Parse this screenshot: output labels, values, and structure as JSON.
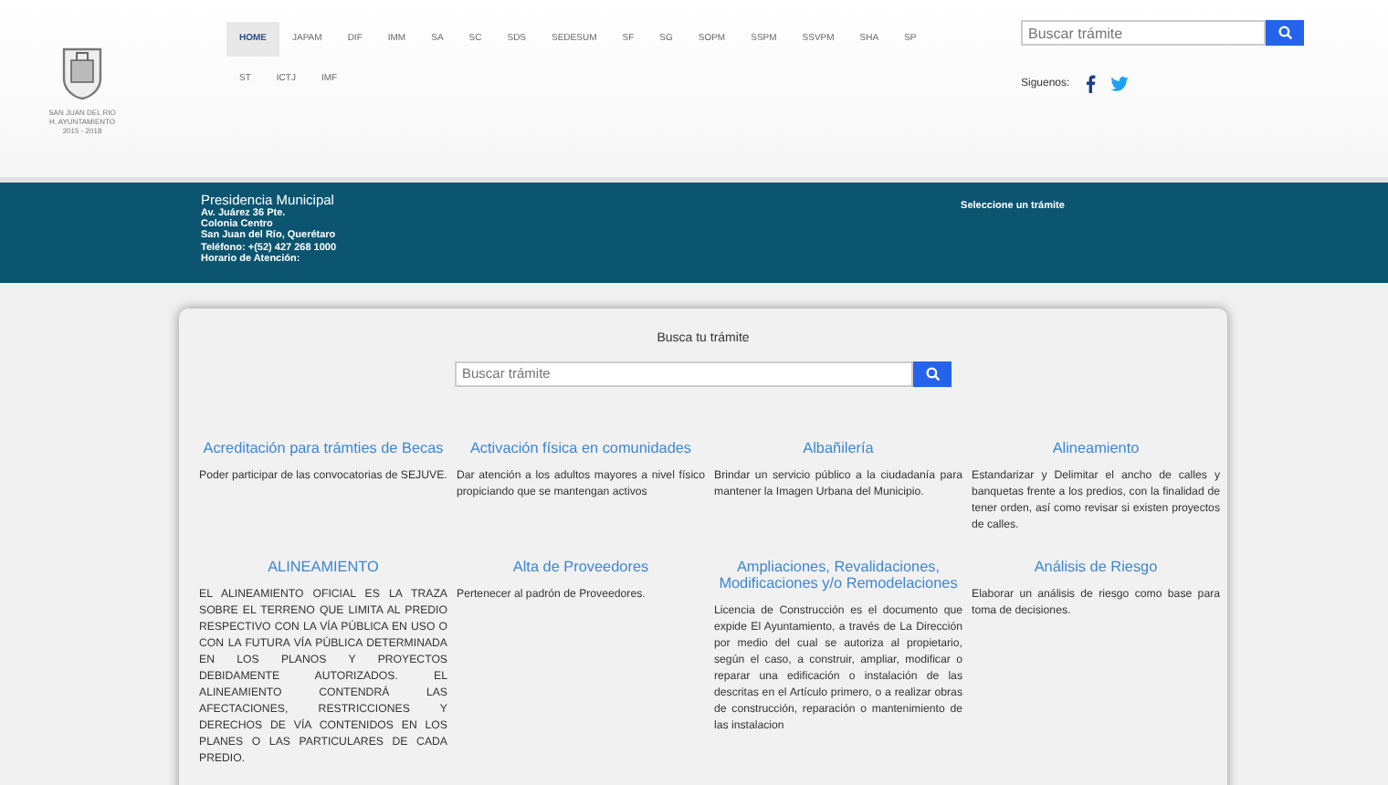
{
  "logo": {
    "caption": [
      "SAN JUAN DEL RIO",
      "H. AYUNTAMIENTO",
      "2015 - 2018"
    ]
  },
  "nav": [
    {
      "label": "HOME",
      "selected": true
    },
    {
      "label": "JAPAM",
      "selected": false
    },
    {
      "label": "DIF",
      "selected": false
    },
    {
      "label": "IMM",
      "selected": false
    },
    {
      "label": "SA",
      "selected": false
    },
    {
      "label": "SC",
      "selected": false
    },
    {
      "label": "SDS",
      "selected": false
    },
    {
      "label": "SEDESUM",
      "selected": false
    },
    {
      "label": "SF",
      "selected": false
    },
    {
      "label": "SG",
      "selected": false
    },
    {
      "label": "SOPM",
      "selected": false
    },
    {
      "label": "SSPM",
      "selected": false
    },
    {
      "label": "SSVPM",
      "selected": false
    },
    {
      "label": "SHA",
      "selected": false
    },
    {
      "label": "SP",
      "selected": false
    },
    {
      "label": "ST",
      "selected": false
    },
    {
      "label": "ICTJ",
      "selected": false
    },
    {
      "label": "IMF",
      "selected": false
    }
  ],
  "header_search": {
    "placeholder": "Buscar trámite"
  },
  "social": {
    "label": "Siguenos:"
  },
  "info_band": {
    "title": "Presidencia Municipal",
    "lines": [
      "Av. Juárez 36 Pte.",
      "Colonia Centro",
      "San Juan del Río, Querétaro",
      "Teléfono: +(52) 427 268 1000",
      "Horario de Atención:"
    ],
    "select_label": "Seleccione un trámite"
  },
  "main": {
    "heading": "Busca tu trámite",
    "search": {
      "placeholder": "Buscar trámite"
    },
    "procedures": [
      {
        "title": "Acreditación para trámties de Becas",
        "description": "Poder participar de las convocatorias de SEJUVE."
      },
      {
        "title": "Activación física en comunidades",
        "description": "Dar atención a los adultos mayores a nivel físico propiciando que se mantengan activos"
      },
      {
        "title": "Albañilería",
        "description": "Brindar un servicio público a la ciudadanía para mantener la Imagen Urbana del Municipio."
      },
      {
        "title": "Alineamiento",
        "description": "Estandarizar y Delimitar el ancho de calles y banquetas frente a los predios, con la finalidad de tener orden, así como revisar si existen proyectos de calles."
      },
      {
        "title": "ALINEAMIENTO",
        "description": "EL ALINEAMIENTO OFICIAL ES LA TRAZA SOBRE EL TERRENO QUE LIMITA AL PREDIO RESPECTIVO CON LA VÍA PÚBLICA EN USO O CON LA FUTURA VÍA PÚBLICA DETERMINADA EN LOS PLANOS Y PROYECTOS DEBIDAMENTE AUTORIZADOS. EL ALINEAMIENTO CONTENDRÁ LAS AFECTACIONES, RESTRICCIONES Y DERECHOS DE VÍA CONTENIDOS EN LOS PLANES O LAS PARTICULARES DE CADA PREDIO."
      },
      {
        "title": "Alta de Proveedores",
        "description": "Pertenecer al padrón de Proveedores."
      },
      {
        "title": "Ampliaciones, Revalidaciones, Modificaciones y/o Remodelaciones",
        "description": "Licencia de Construcción es el documento que expide El Ayuntamiento, a través de La Dirección por medio del cual se autoriza al propietario, según el caso, a construir, ampliar, modificar o reparar una edificación o instalación de las descritas en el Artículo primero, o a realizar obras de construcción, reparación o mantenimiento de las instalacion"
      },
      {
        "title": "Análisis de Riesgo",
        "description": "Elaborar un análisis de riesgo como base para toma de decisiones."
      }
    ]
  }
}
